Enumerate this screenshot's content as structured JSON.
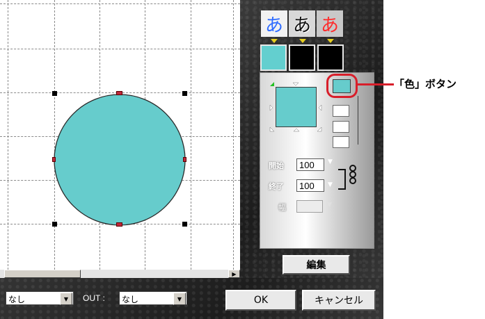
{
  "panel": {
    "font_styles": [
      {
        "label": "あ",
        "color": "#2f6cff",
        "bg": "#f2f2f2"
      },
      {
        "label": "あ",
        "color": "#101010",
        "bg": "#d8d8d8"
      },
      {
        "label": "あ",
        "color": "#ff2a2a",
        "bg": "#c8c8c8"
      }
    ],
    "swatches": [
      "#63cfcf",
      "#000000",
      "#000000"
    ],
    "gradient": {
      "start_label": "開始",
      "start_value": "100",
      "end_label": "終了",
      "end_value": "100",
      "width_label": "幅",
      "width_value": ""
    },
    "edit_button": "編集",
    "ok_button": "OK",
    "cancel_button": "キャンセル"
  },
  "canvas": {
    "shape": "circle",
    "fill_color": "#66cccc"
  },
  "bottom": {
    "in_select": "なし",
    "out_label": "OUT :",
    "out_select": "なし"
  },
  "annotation": {
    "label": "「色」ボタン",
    "color": "#d81e2a"
  }
}
